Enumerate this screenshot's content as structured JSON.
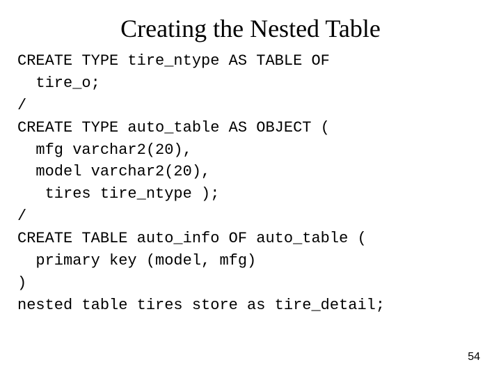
{
  "slide": {
    "title": "Creating the Nested Table",
    "code": "CREATE TYPE tire_ntype AS TABLE OF\n  tire_o;\n/\nCREATE TYPE auto_table AS OBJECT (\n  mfg varchar2(20),\n  model varchar2(20),\n   tires tire_ntype );\n/\nCREATE TABLE auto_info OF auto_table (\n  primary key (model, mfg)\n)\nnested table tires store as tire_detail;",
    "page_number": "54"
  }
}
